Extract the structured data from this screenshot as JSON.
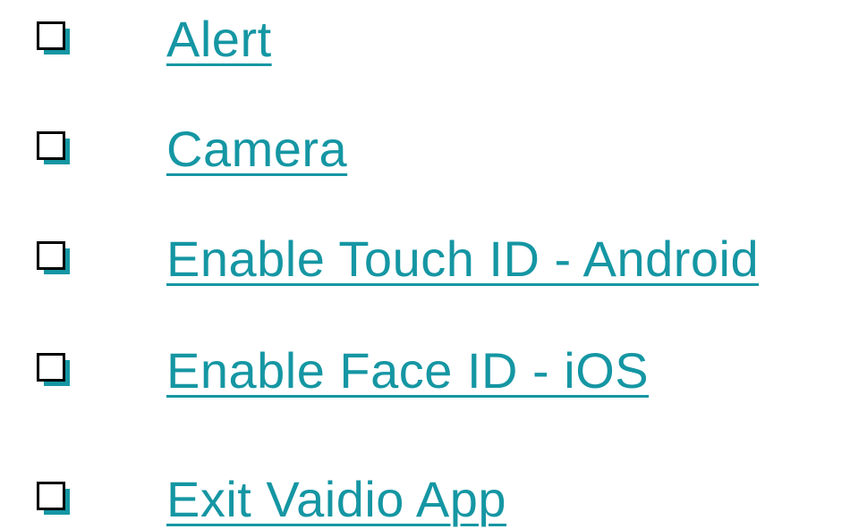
{
  "colors": {
    "link": "#1596a3",
    "bullet_face": "#ffffff",
    "bullet_edge": "#000000",
    "bullet_shadow": "#1596a3"
  },
  "bullet_icon": "checkbox-bullet-icon",
  "items": [
    {
      "label": "Alert"
    },
    {
      "label": "Camera"
    },
    {
      "label": "Enable Touch ID - Android"
    },
    {
      "label": "Enable Face ID - iOS"
    },
    {
      "label": "Exit Vaidio App"
    }
  ]
}
